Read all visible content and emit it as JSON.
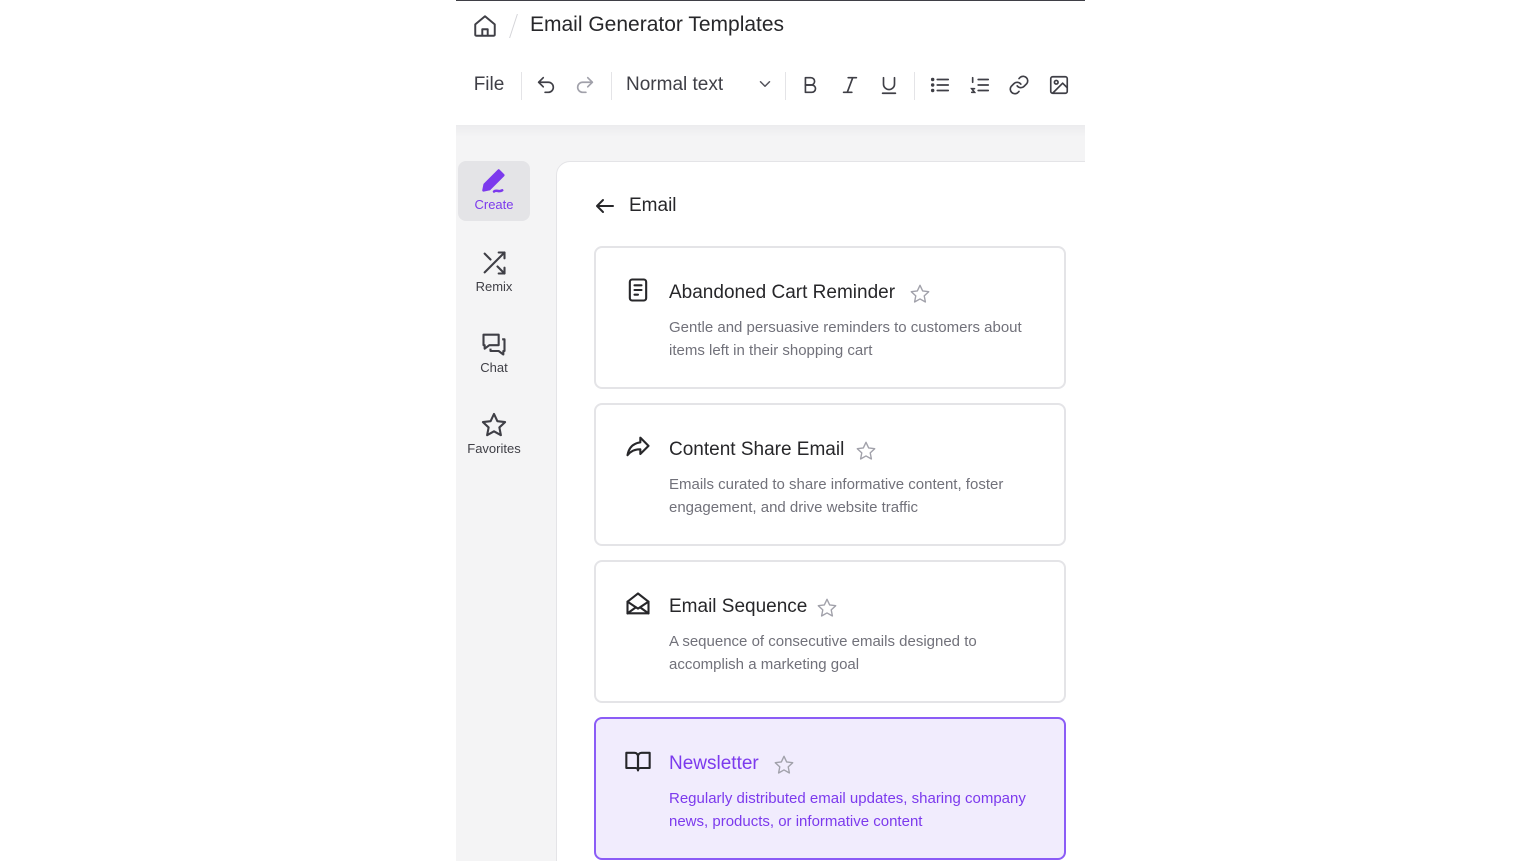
{
  "header": {
    "breadcrumb_icon": "home-icon",
    "title": "Email Generator Templates"
  },
  "toolbar": {
    "file_label": "File",
    "text_style": "Normal text",
    "icons": [
      "undo-icon",
      "redo-icon",
      "chevron-down-icon",
      "bold-icon",
      "italic-icon",
      "underline-icon",
      "bullet-list-icon",
      "numbered-list-icon",
      "link-icon",
      "image-icon"
    ]
  },
  "sidebar": {
    "items": [
      {
        "label": "Create",
        "icon": "pen-icon",
        "active": true
      },
      {
        "label": "Remix",
        "icon": "shuffle-icon",
        "active": false
      },
      {
        "label": "Chat",
        "icon": "chat-icon",
        "active": false
      },
      {
        "label": "Favorites",
        "icon": "star-icon",
        "active": false
      }
    ]
  },
  "panel": {
    "title": "Email",
    "templates": [
      {
        "title": "Abandoned Cart Reminder",
        "description": "Gentle and persuasive reminders to customers about items left in their shopping cart",
        "icon": "document-icon"
      },
      {
        "title": "Content Share Email",
        "description": "Emails curated to share informative content, foster engagement, and drive website traffic",
        "icon": "share-arrow-icon"
      },
      {
        "title": "Email Sequence",
        "description": "A sequence of consecutive emails designed to accomplish a marketing goal",
        "icon": "envelope-icon"
      },
      {
        "title": "Newsletter",
        "description": "Regularly distributed email updates, sharing company news, products, or informative content",
        "icon": "book-icon",
        "selected": true
      }
    ]
  },
  "colors": {
    "accent": "#7c3aed",
    "selected_background": "#f1ecfd",
    "selected_border": "#8b5cf6"
  }
}
